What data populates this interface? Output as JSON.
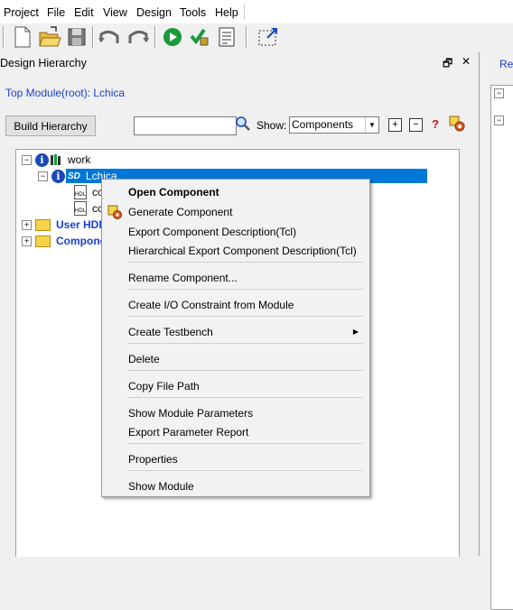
{
  "menubar": {
    "items": [
      "Project",
      "File",
      "Edit",
      "View",
      "Design",
      "Tools",
      "Help"
    ]
  },
  "toolbar": {
    "icons": [
      "new-file-icon",
      "open-folder-icon",
      "save-icon",
      "undo-icon",
      "redo-icon",
      "run-icon",
      "verify-icon",
      "checklist-icon",
      "resize-icon"
    ]
  },
  "panel": {
    "title": "Design Hierarchy",
    "restore_glyph": "🗗",
    "close_glyph": "✕",
    "top_module": "Top Module(root): Lchica",
    "build_button": "Build Hierarchy",
    "search": {
      "value": ""
    },
    "show_label": "Show:",
    "show_value": "Components",
    "show_arrow": "▼",
    "expand_all": "+",
    "collapse_all": "−",
    "help_glyph": "?"
  },
  "tree": {
    "work_label": "work",
    "lchica_label": "Lchica",
    "sd_label": "SD",
    "child1_label": "cc",
    "child2_label": "cc",
    "user_hdl_label": "User HDL",
    "components_label": "Compone",
    "expanded_glyph": "−",
    "collapsed_glyph": "+"
  },
  "right_panel": {
    "tab": "Re"
  },
  "context_menu": {
    "open_component": "Open Component",
    "generate_component": "Generate Component",
    "export_desc": "Export Component Description(Tcl)",
    "hier_export_desc": "Hierarchical Export Component Description(Tcl)",
    "rename_component": "Rename Component...",
    "create_io": "Create I/O Constraint from Module",
    "create_testbench": "Create Testbench",
    "submenu_arrow": "▶",
    "delete": "Delete",
    "copy_file_path": "Copy File Path",
    "show_module_params": "Show Module Parameters",
    "export_param_report": "Export Parameter Report",
    "properties": "Properties",
    "show_module": "Show Module"
  },
  "colors": {
    "accent": "#0078d7",
    "link": "#1a3fd6",
    "run_green": "#1a9a3a"
  }
}
